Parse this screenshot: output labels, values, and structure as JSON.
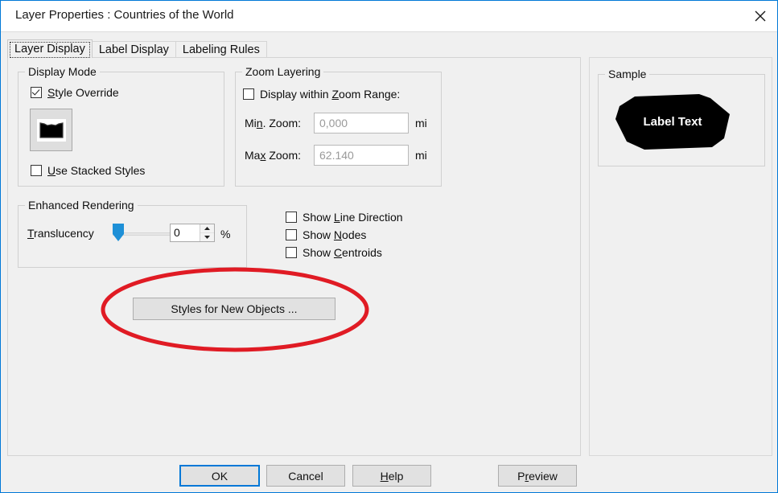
{
  "window": {
    "title_prefix": "Layer Properties",
    "title_separator": ":",
    "title_layer": "Countries of the World",
    "title_full": "Layer Properties  : Countries of the World",
    "close_icon": "close-icon",
    "accent_color": "#0078d7",
    "body_color": "#f0f0f0"
  },
  "tabs": [
    {
      "label": "Layer Display",
      "active": true
    },
    {
      "label": "Label Display",
      "active": false
    },
    {
      "label": "Labeling Rules",
      "active": false
    }
  ],
  "display_mode": {
    "group_title": "Display Mode",
    "style_override": {
      "label": "Style Override",
      "accel": "S",
      "checked": true
    },
    "style_swatch": {
      "name": "style-preview-swatch",
      "shape": "polygon",
      "fill": "#000000"
    },
    "use_stacked_styles": {
      "label": "Use Stacked Styles",
      "accel": "U",
      "checked": false
    }
  },
  "zoom_layering": {
    "group_title": "Zoom Layering",
    "display_within_range": {
      "label_pre": "Display within ",
      "accel": "Z",
      "label_post": "oom Range:",
      "checked": false
    },
    "min_zoom": {
      "label_pre": "Mi",
      "accel": "n",
      "label_post": ". Zoom:",
      "value": "0,000",
      "unit": "mi",
      "disabled": true
    },
    "max_zoom": {
      "label_pre": "Ma",
      "accel": "x",
      "label_post": " Zoom:",
      "value": "62.140",
      "unit": "mi",
      "disabled": true
    }
  },
  "enhanced_rendering": {
    "group_title": "Enhanced Rendering",
    "translucency": {
      "label_pre": "",
      "accel": "T",
      "label_post": "ranslucency",
      "value": "0",
      "unit": "%",
      "slider_position_pct": 0,
      "thumb_color": "#1e90d7"
    }
  },
  "display_options": [
    {
      "label_pre": "Show ",
      "accel": "L",
      "label_post": "ine Direction",
      "checked": false,
      "name": "show-line-direction"
    },
    {
      "label_pre": "Show ",
      "accel": "N",
      "label_post": "odes",
      "checked": false,
      "name": "show-nodes"
    },
    {
      "label_pre": "Show ",
      "accel": "C",
      "label_post": "entroids",
      "checked": false,
      "name": "show-centroids"
    }
  ],
  "styles_button": {
    "label": "Styles for New Objects ...",
    "highlight": {
      "shape": "ellipse",
      "color": "#e01b24",
      "stroke_width": 5
    }
  },
  "sample": {
    "group_title": "Sample",
    "label_text": "Label Text",
    "fill_color": "#000000",
    "text_color": "#ffffff"
  },
  "footer": {
    "ok": {
      "label": "OK",
      "default": true
    },
    "cancel": {
      "label": "Cancel"
    },
    "help": {
      "label_pre": "",
      "accel": "H",
      "label_post": "elp"
    },
    "preview": {
      "label_pre": "P",
      "accel": "r",
      "label_post": "eview"
    }
  }
}
